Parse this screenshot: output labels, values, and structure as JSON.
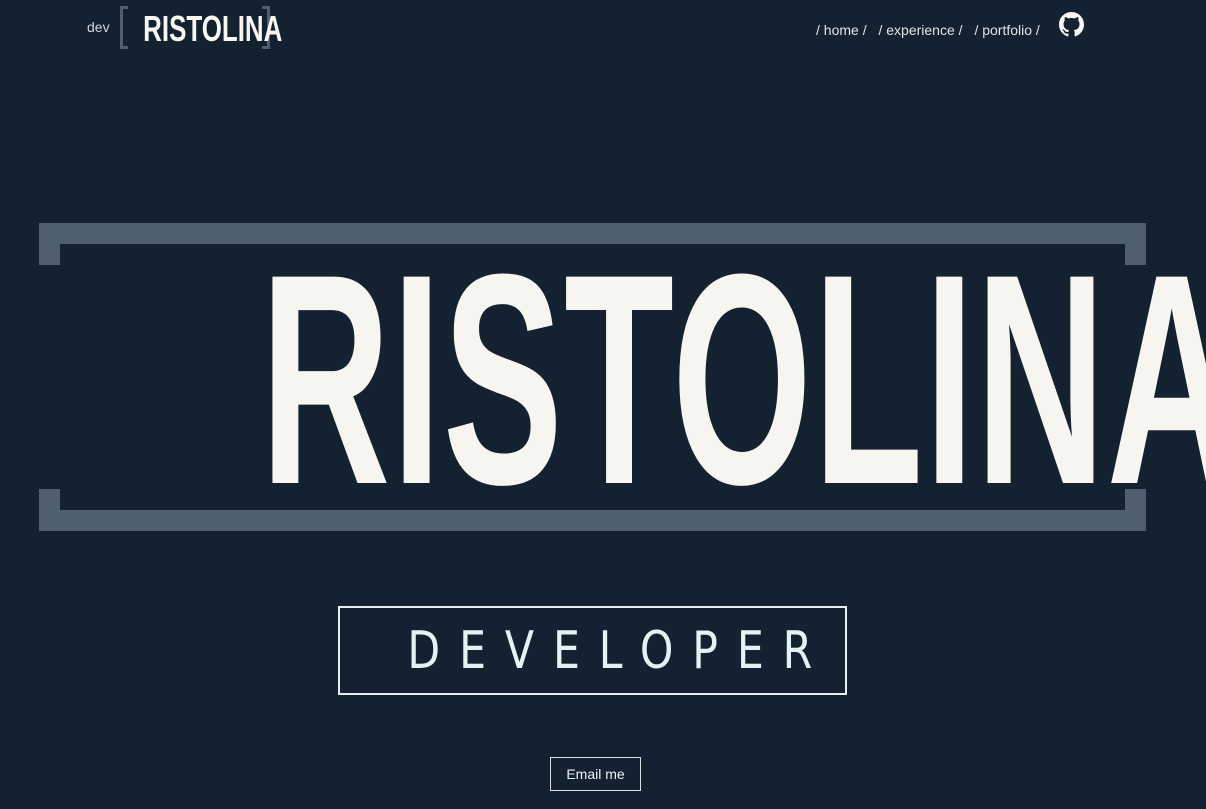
{
  "header": {
    "brand_prefix": "dev",
    "brand_logo": "RISTOLINA",
    "nav": [
      {
        "label": "/ home /"
      },
      {
        "label": "/ experience /"
      },
      {
        "label": "/ portfolio /"
      }
    ],
    "github_icon": "github-icon"
  },
  "hero": {
    "title": "RISTOLINA",
    "role": "DEVELOPER",
    "email_button": "Email me"
  },
  "colors": {
    "background": "#142130",
    "frame": "#4e6070",
    "text_light": "#f7f5f0",
    "role_text": "#e4f2f4"
  }
}
